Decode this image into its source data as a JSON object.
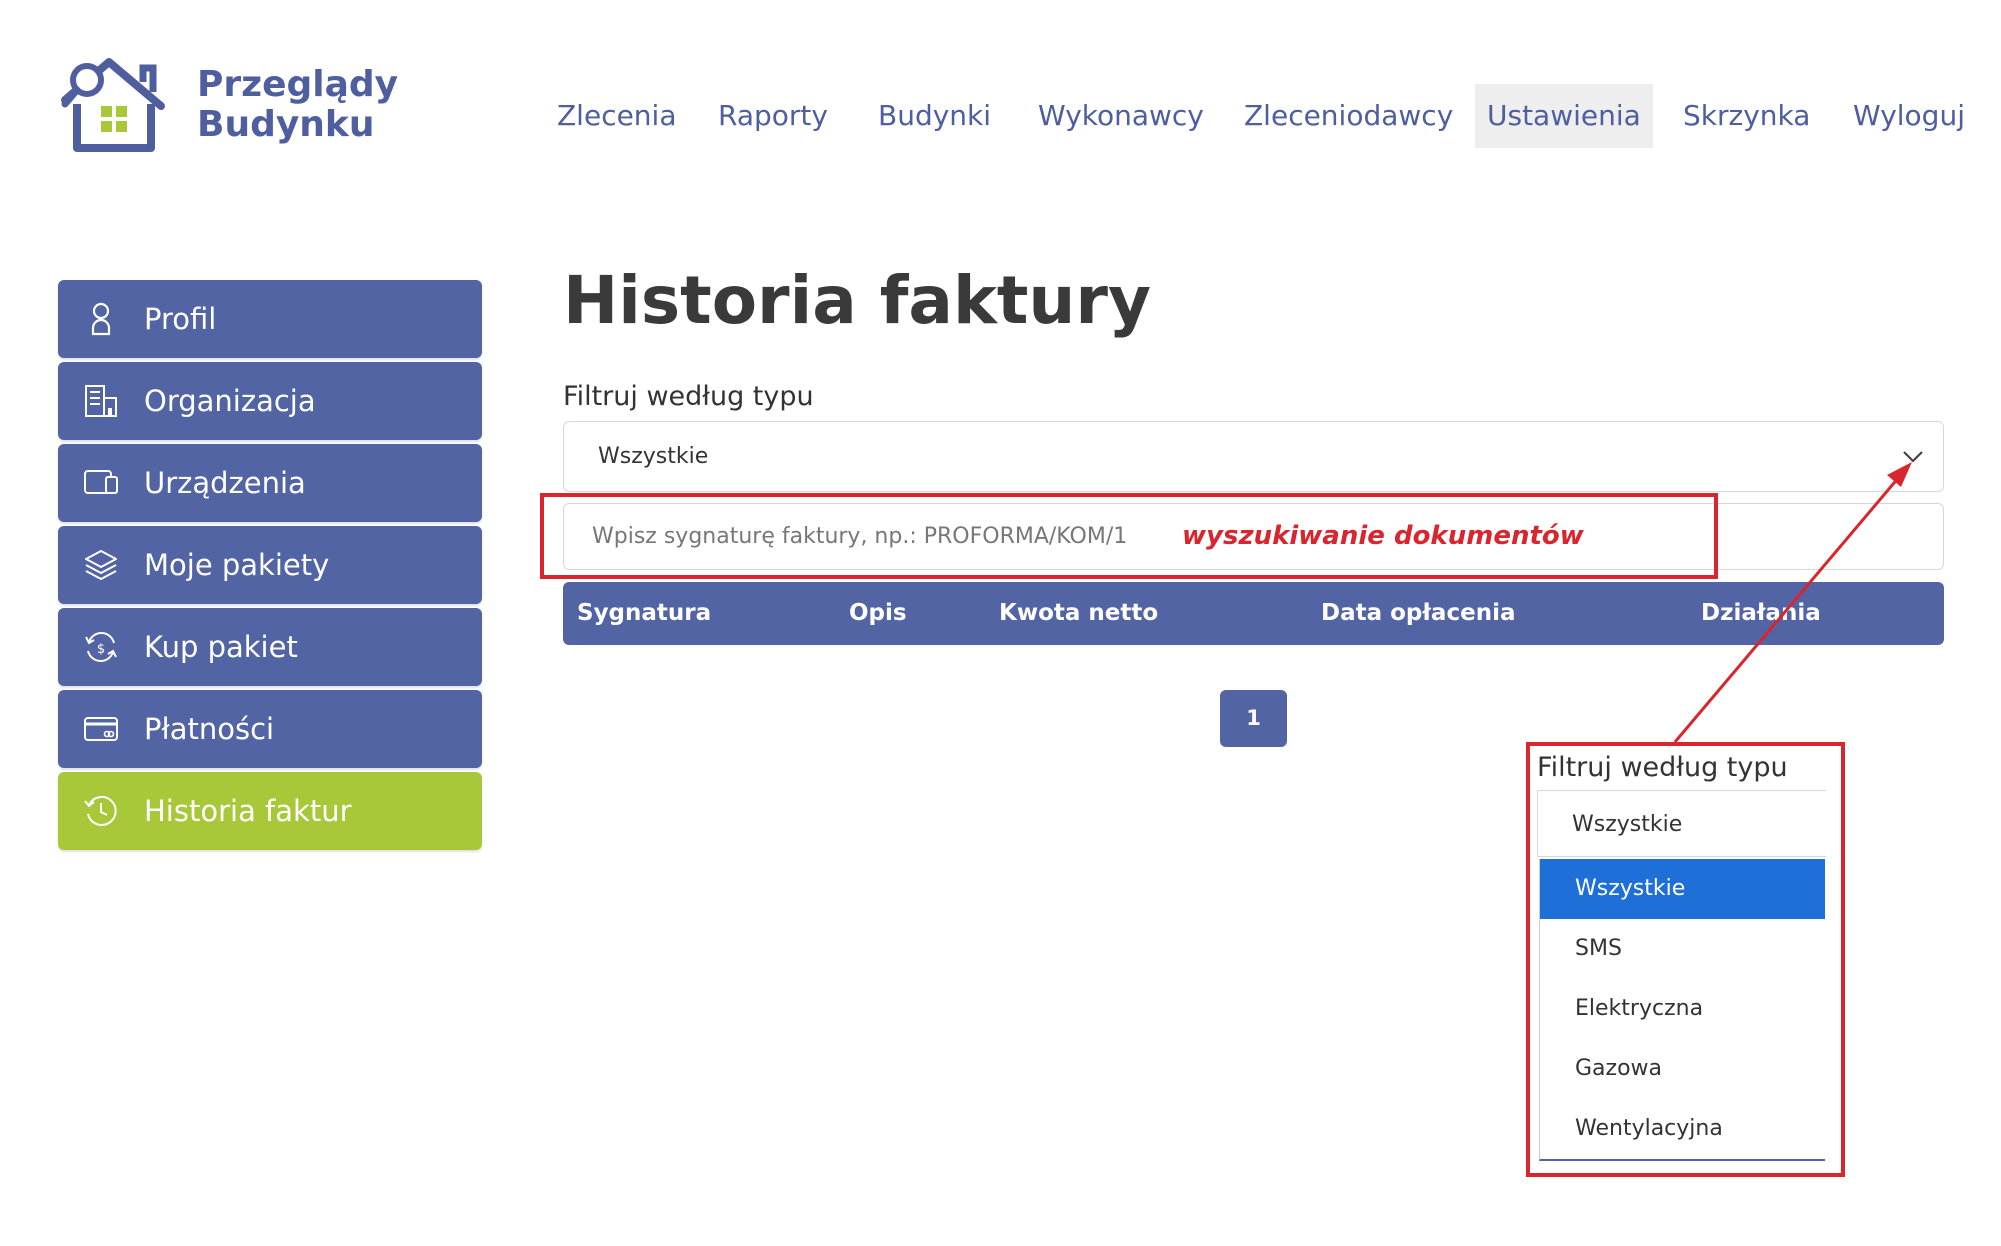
{
  "brand": {
    "line1": "Przeglądy",
    "line2": "Budynku",
    "color": "#4e5e9f",
    "accent": "#a8c83a"
  },
  "nav": {
    "items": [
      {
        "label": "Zlecenia"
      },
      {
        "label": "Raporty"
      },
      {
        "label": "Budynki"
      },
      {
        "label": "Wykonawcy"
      },
      {
        "label": "Zleceniodawcy"
      },
      {
        "label": "Ustawienia",
        "active": true
      },
      {
        "label": "Skrzynka"
      },
      {
        "label": "Wyloguj"
      }
    ]
  },
  "sidebar": {
    "items": [
      {
        "label": "Profil",
        "icon": "user-icon"
      },
      {
        "label": "Organizacja",
        "icon": "building-icon"
      },
      {
        "label": "Urządzenia",
        "icon": "devices-icon"
      },
      {
        "label": "Moje pakiety",
        "icon": "layers-icon"
      },
      {
        "label": "Kup pakiet",
        "icon": "buy-package-icon"
      },
      {
        "label": "Płatności",
        "icon": "card-icon"
      },
      {
        "label": "Historia faktur",
        "icon": "history-icon",
        "active": true
      }
    ]
  },
  "main": {
    "title": "Historia faktury",
    "filter": {
      "label": "Filtruj według typu",
      "value": "Wszystkie"
    },
    "search": {
      "placeholder": "Wpisz sygnaturę faktury, np.: PROFORMA/KOM/1"
    },
    "annotation": "wyszukiwanie dokumentów",
    "table": {
      "columns": [
        "Sygnatura",
        "Opis",
        "Kwota netto",
        "Data opłacenia",
        "Działania"
      ]
    },
    "pagination": {
      "current": "1"
    }
  },
  "dropdown_inset": {
    "label": "Filtruj według typu",
    "value": "Wszystkie",
    "options": [
      "Wszystkie",
      "SMS",
      "Elektryczna",
      "Gazowa",
      "Wentylacyjna"
    ],
    "selected": "Wszystkie"
  },
  "colors": {
    "primary": "#5264a3",
    "active_green": "#a8c83a",
    "annotation_red": "#d9252e",
    "option_highlight": "#1f6fd8"
  }
}
